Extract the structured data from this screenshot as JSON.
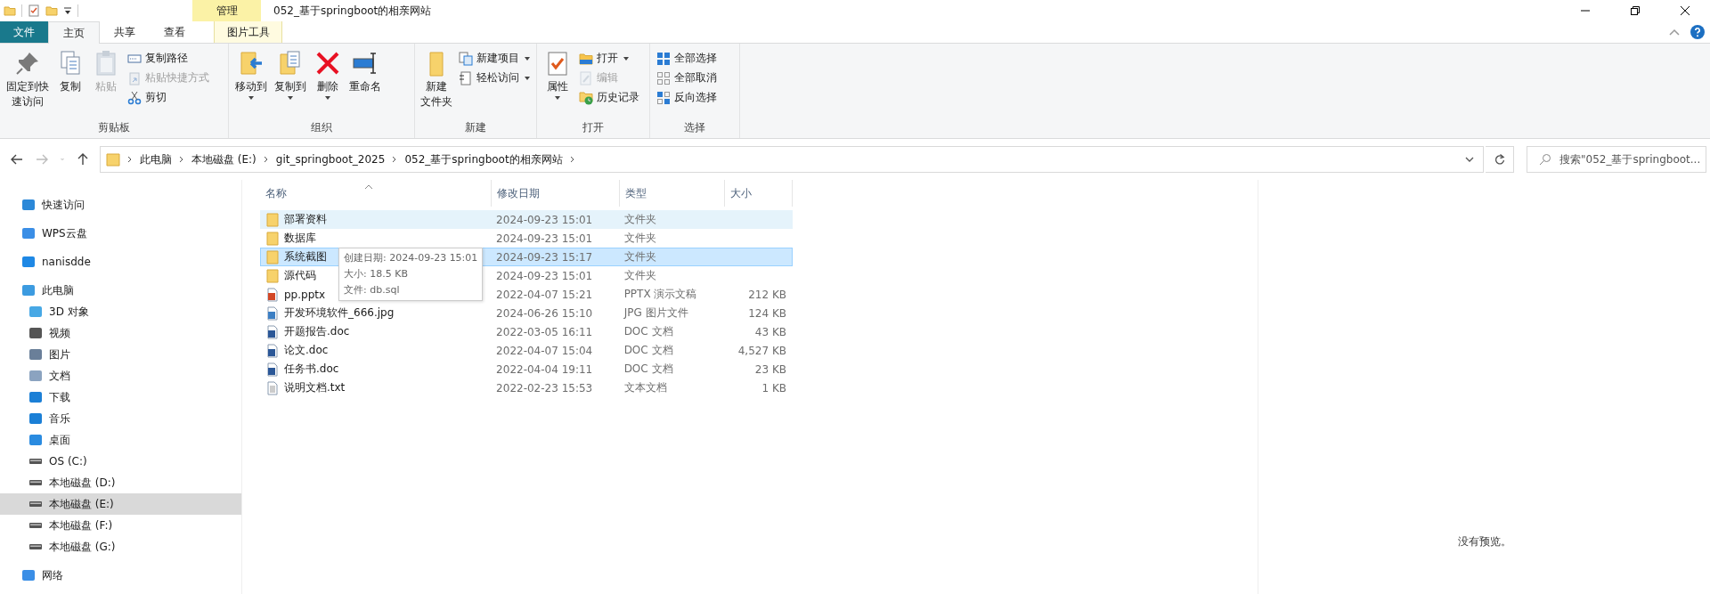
{
  "title_bar": {
    "contextual_tab": "管理",
    "title": "052_基于springboot的相亲网站"
  },
  "ribbon_tabs": [
    {
      "label": "文件",
      "kind": "file",
      "selected": false
    },
    {
      "label": "主页",
      "kind": "normal",
      "selected": true
    },
    {
      "label": "共享",
      "kind": "normal",
      "selected": false
    },
    {
      "label": "查看",
      "kind": "normal",
      "selected": false
    },
    {
      "label": "图片工具",
      "kind": "contextual",
      "selected": false
    }
  ],
  "ribbon_groups": [
    {
      "label": "剪贴板",
      "commands": [
        {
          "kind": "large",
          "lines": [
            "固定到快",
            "速访问"
          ],
          "disabled": false,
          "dropdown": false
        },
        {
          "kind": "large",
          "lines": [
            "复制"
          ],
          "disabled": false,
          "dropdown": false
        },
        {
          "kind": "large",
          "lines": [
            "粘贴"
          ],
          "disabled": true,
          "dropdown": false
        },
        {
          "kind": "small",
          "lines": [
            "复制路径"
          ],
          "disabled": false,
          "dropdown": false
        },
        {
          "kind": "small",
          "lines": [
            "粘贴快捷方式"
          ],
          "disabled": true,
          "dropdown": false
        },
        {
          "kind": "small",
          "lines": [
            "剪切"
          ],
          "disabled": false,
          "dropdown": false
        }
      ]
    },
    {
      "label": "组织",
      "commands": [
        {
          "kind": "large",
          "lines": [
            "移动到"
          ],
          "disabled": false,
          "dropdown": true
        },
        {
          "kind": "large",
          "lines": [
            "复制到"
          ],
          "disabled": false,
          "dropdown": true
        },
        {
          "kind": "large",
          "lines": [
            "删除"
          ],
          "disabled": false,
          "dropdown": true
        },
        {
          "kind": "large",
          "lines": [
            "重命名"
          ],
          "disabled": false,
          "dropdown": false
        }
      ]
    },
    {
      "label": "新建",
      "commands": [
        {
          "kind": "large",
          "lines": [
            "新建",
            "文件夹"
          ],
          "disabled": false,
          "dropdown": false
        },
        {
          "kind": "small",
          "lines": [
            "新建项目"
          ],
          "disabled": false,
          "dropdown": true
        },
        {
          "kind": "small",
          "lines": [
            "轻松访问"
          ],
          "disabled": false,
          "dropdown": true
        }
      ]
    },
    {
      "label": "打开",
      "commands": [
        {
          "kind": "large",
          "lines": [
            "属性"
          ],
          "disabled": false,
          "dropdown": true
        },
        {
          "kind": "small",
          "lines": [
            "打开"
          ],
          "disabled": false,
          "dropdown": true
        },
        {
          "kind": "small",
          "lines": [
            "编辑"
          ],
          "disabled": true,
          "dropdown": false
        },
        {
          "kind": "small",
          "lines": [
            "历史记录"
          ],
          "disabled": false,
          "dropdown": false
        }
      ]
    },
    {
      "label": "选择",
      "commands": [
        {
          "kind": "small",
          "lines": [
            "全部选择"
          ],
          "disabled": false,
          "dropdown": false
        },
        {
          "kind": "small",
          "lines": [
            "全部取消"
          ],
          "disabled": false,
          "dropdown": false
        },
        {
          "kind": "small",
          "lines": [
            "反向选择"
          ],
          "disabled": false,
          "dropdown": false
        }
      ]
    }
  ],
  "address_bar": {
    "segments": [
      "此电脑",
      "本地磁盘 (E:)",
      "git_springboot_2025",
      "052_基于springboot的相亲网站"
    ]
  },
  "search": {
    "placeholder": "搜索\"052_基于springboot..."
  },
  "sidebar": {
    "items": [
      {
        "label": "快速访问",
        "kind": "star",
        "selected": false
      },
      {
        "label": "WPS云盘",
        "kind": "cloud",
        "selected": false
      },
      {
        "label": "nanisdde",
        "kind": "user",
        "selected": false
      },
      {
        "label": "此电脑",
        "kind": "pc",
        "selected": false,
        "children": [
          {
            "label": "3D 对象",
            "kind": "cube",
            "selected": false
          },
          {
            "label": "视频",
            "kind": "video",
            "selected": false
          },
          {
            "label": "图片",
            "kind": "image",
            "selected": false
          },
          {
            "label": "文档",
            "kind": "doc",
            "selected": false
          },
          {
            "label": "下载",
            "kind": "download",
            "selected": false
          },
          {
            "label": "音乐",
            "kind": "music",
            "selected": false
          },
          {
            "label": "桌面",
            "kind": "desktop",
            "selected": false
          },
          {
            "label": "OS (C:)",
            "kind": "osdrive",
            "selected": false
          },
          {
            "label": "本地磁盘 (D:)",
            "kind": "drive",
            "selected": false
          },
          {
            "label": "本地磁盘 (E:)",
            "kind": "drive",
            "selected": true
          },
          {
            "label": "本地磁盘 (F:)",
            "kind": "drive",
            "selected": false
          },
          {
            "label": "本地磁盘 (G:)",
            "kind": "drive",
            "selected": false
          }
        ]
      },
      {
        "label": "网络",
        "kind": "network",
        "selected": false
      }
    ]
  },
  "file_list": {
    "columns": [
      "名称",
      "修改日期",
      "类型",
      "大小"
    ],
    "rows": [
      {
        "name": "部署资料",
        "date": "2024-09-23 15:01",
        "type": "文件夹",
        "size": "",
        "kind": "folder",
        "hovered": true,
        "selected": false
      },
      {
        "name": "数据库",
        "date": "2024-09-23 15:01",
        "type": "文件夹",
        "size": "",
        "kind": "folder",
        "hovered": false,
        "selected": false
      },
      {
        "name": "系统截图",
        "date": "2024-09-23 15:17",
        "type": "文件夹",
        "size": "",
        "kind": "folder",
        "hovered": false,
        "selected": true
      },
      {
        "name": "源代码",
        "date": "2024-09-23 15:01",
        "type": "文件夹",
        "size": "",
        "kind": "folder",
        "hovered": false,
        "selected": false
      },
      {
        "name": "pp.pptx",
        "date": "2022-04-07 15:21",
        "type": "PPTX 演示文稿",
        "size": "212 KB",
        "kind": "pptx",
        "hovered": false,
        "selected": false
      },
      {
        "name": "开发环境软件_666.jpg",
        "date": "2024-06-26 15:10",
        "type": "JPG 图片文件",
        "size": "124 KB",
        "kind": "jpg",
        "hovered": false,
        "selected": false
      },
      {
        "name": "开题报告.doc",
        "date": "2022-03-05 16:11",
        "type": "DOC 文档",
        "size": "43 KB",
        "kind": "doc",
        "hovered": false,
        "selected": false
      },
      {
        "name": "论文.doc",
        "date": "2022-04-07 15:04",
        "type": "DOC 文档",
        "size": "4,527 KB",
        "kind": "doc",
        "hovered": false,
        "selected": false
      },
      {
        "name": "任务书.doc",
        "date": "2022-04-04 19:11",
        "type": "DOC 文档",
        "size": "23 KB",
        "kind": "doc",
        "hovered": false,
        "selected": false
      },
      {
        "name": "说明文档.txt",
        "date": "2022-02-23 15:53",
        "type": "文本文档",
        "size": "1 KB",
        "kind": "txt",
        "hovered": false,
        "selected": false
      }
    ]
  },
  "tooltip": {
    "lines": [
      "创建日期: 2024-09-23 15:01",
      "大小: 18.5 KB",
      "文件: db.sql"
    ]
  },
  "preview_pane": {
    "message": "没有预览。"
  }
}
